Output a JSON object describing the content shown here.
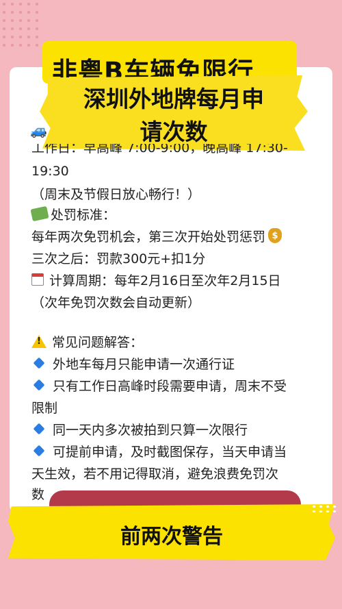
{
  "title": {
    "line1": "非粤B车辆免限行",
    "line2a": "深圳外地牌每月申",
    "line2b": "请次数"
  },
  "schedule": {
    "clipped_line": "工作日：早高峰 7:00-9:00，晚高峰 17:30-",
    "cont": "19:30",
    "weekend": "（周末及节假日放心畅行！）"
  },
  "penalty": {
    "heading": "处罚标准：",
    "line1": "每年两次免罚机会，第三次开始处罚惩罚",
    "line2": "三次之后：罚款300元+扣1分"
  },
  "period": {
    "line1": "计算周期：每年2月16日至次年2月15日",
    "line2": "（次年免罚次数会自动更新）"
  },
  "faq": {
    "heading": "常见问题解答：",
    "items": [
      [
        "外地车每月只能申请一次通行证"
      ],
      [
        "只有工作日高峰时段需要申请，周末不受",
        "限制"
      ],
      [
        "同一天内多次被拍到只算一次限行"
      ],
      [
        "可提前申请，及时截图保存，当天申请当",
        "天生效，若不用记得取消，避免浪费免罚次",
        "数"
      ]
    ]
  },
  "banner": "前两次警告",
  "icons": [
    "car-icon",
    "money-icon",
    "coin-icon",
    "calendar-icon",
    "warning-icon",
    "diamond-icon"
  ],
  "colors": {
    "background": "#f6b8bf",
    "yellow": "#fbe200",
    "accent": "#b33a4a",
    "bullet": "#2b7de1"
  }
}
